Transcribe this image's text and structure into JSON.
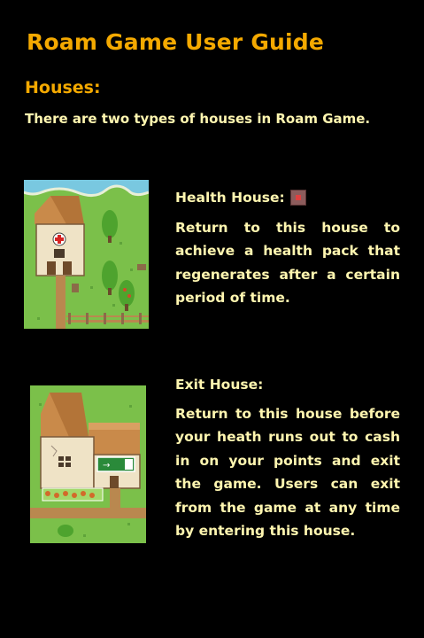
{
  "guide": {
    "title": "Roam Game User Guide",
    "houses_heading": "Houses:",
    "intro": "There are two types of houses in Roam Game."
  },
  "health_house": {
    "title": "Health House:",
    "icon": "health-pack-icon",
    "description": "Return to this house to achieve a health pack that regenerates after a certain period of time."
  },
  "exit_house": {
    "title": "Exit House:",
    "description": "Return to this house before your heath runs out to cash in on your points and exit the game. Users can exit from the game at any time by entering this house.",
    "sign_icon": "exit-sign-icon"
  },
  "colors": {
    "heading": "#f4a900",
    "body_text": "#fff6b0",
    "background": "#000000"
  }
}
